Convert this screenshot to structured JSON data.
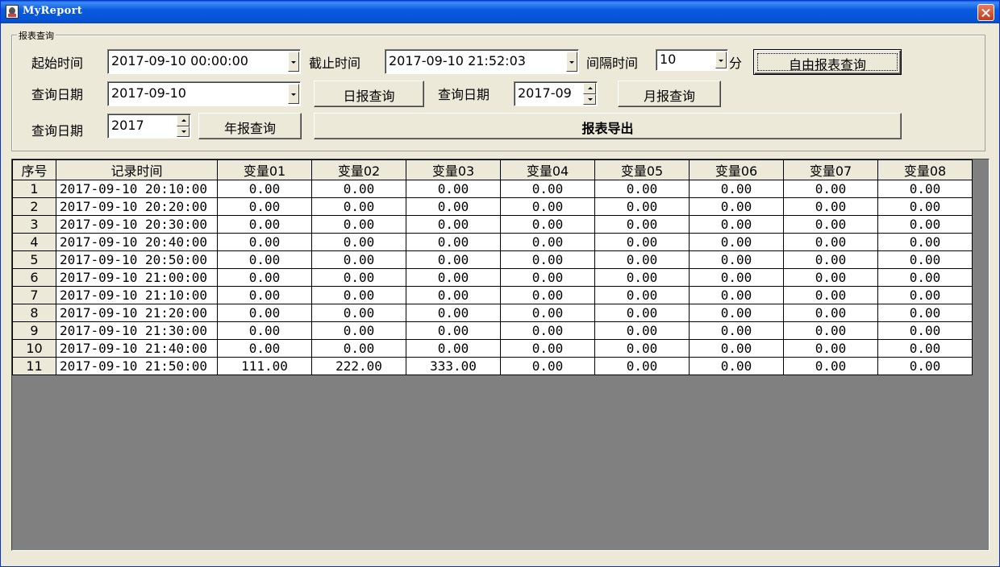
{
  "window": {
    "title": "MyReport"
  },
  "query_panel": {
    "group_title": "报表查询",
    "start_time_label": "起始时间",
    "start_time_value": "2017-09-10 00:00:00",
    "end_time_label": "截止时间",
    "end_time_value": "2017-09-10 21:52:03",
    "interval_label": "间隔时间",
    "interval_value": "10",
    "interval_unit": "分",
    "free_report_button": "自由报表查询",
    "daily_date_label": "查询日期",
    "daily_date_value": "2017-09-10",
    "daily_report_button": "日报查询",
    "monthly_date_label": "查询日期",
    "monthly_date_value": "2017-09",
    "monthly_report_button": "月报查询",
    "yearly_date_label": "查询日期",
    "yearly_date_value": "2017",
    "yearly_report_button": "年报查询",
    "export_button": "报表导出"
  },
  "table": {
    "headers": [
      "序号",
      "记录时间",
      "变量01",
      "变量02",
      "变量03",
      "变量04",
      "变量05",
      "变量06",
      "变量07",
      "变量08"
    ],
    "rows": [
      [
        "1",
        "2017-09-10 20:10:00",
        "0.00",
        "0.00",
        "0.00",
        "0.00",
        "0.00",
        "0.00",
        "0.00",
        "0.00"
      ],
      [
        "2",
        "2017-09-10 20:20:00",
        "0.00",
        "0.00",
        "0.00",
        "0.00",
        "0.00",
        "0.00",
        "0.00",
        "0.00"
      ],
      [
        "3",
        "2017-09-10 20:30:00",
        "0.00",
        "0.00",
        "0.00",
        "0.00",
        "0.00",
        "0.00",
        "0.00",
        "0.00"
      ],
      [
        "4",
        "2017-09-10 20:40:00",
        "0.00",
        "0.00",
        "0.00",
        "0.00",
        "0.00",
        "0.00",
        "0.00",
        "0.00"
      ],
      [
        "5",
        "2017-09-10 20:50:00",
        "0.00",
        "0.00",
        "0.00",
        "0.00",
        "0.00",
        "0.00",
        "0.00",
        "0.00"
      ],
      [
        "6",
        "2017-09-10 21:00:00",
        "0.00",
        "0.00",
        "0.00",
        "0.00",
        "0.00",
        "0.00",
        "0.00",
        "0.00"
      ],
      [
        "7",
        "2017-09-10 21:10:00",
        "0.00",
        "0.00",
        "0.00",
        "0.00",
        "0.00",
        "0.00",
        "0.00",
        "0.00"
      ],
      [
        "8",
        "2017-09-10 21:20:00",
        "0.00",
        "0.00",
        "0.00",
        "0.00",
        "0.00",
        "0.00",
        "0.00",
        "0.00"
      ],
      [
        "9",
        "2017-09-10 21:30:00",
        "0.00",
        "0.00",
        "0.00",
        "0.00",
        "0.00",
        "0.00",
        "0.00",
        "0.00"
      ],
      [
        "10",
        "2017-09-10 21:40:00",
        "0.00",
        "0.00",
        "0.00",
        "0.00",
        "0.00",
        "0.00",
        "0.00",
        "0.00"
      ],
      [
        "11",
        "2017-09-10 21:50:00",
        "111.00",
        "222.00",
        "333.00",
        "0.00",
        "0.00",
        "0.00",
        "0.00",
        "0.00"
      ]
    ]
  },
  "icons": {
    "app": "app-icon",
    "close": "close-icon",
    "dropdown": "chevron-down-icon",
    "spin": "spinner-icon"
  },
  "colors": {
    "titlebar": "#0653d4",
    "face": "#ece9d8",
    "grid_background": "#808080",
    "close_button": "#c4391b"
  }
}
